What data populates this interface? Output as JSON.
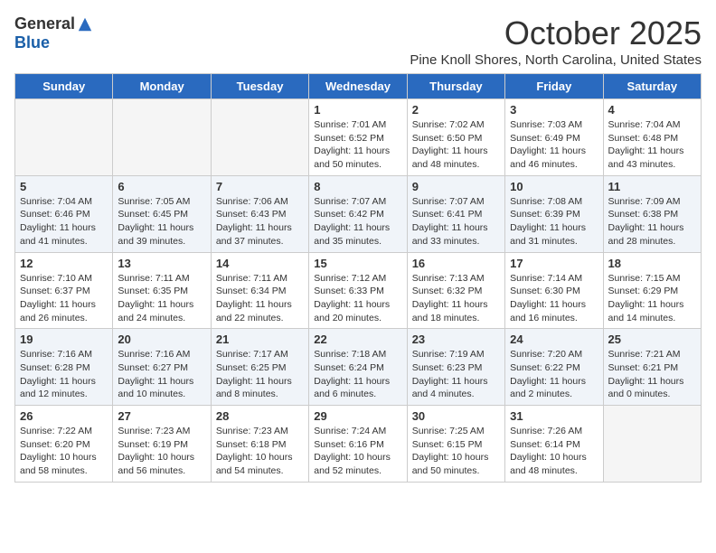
{
  "header": {
    "logo_general": "General",
    "logo_blue": "Blue",
    "month": "October 2025",
    "location": "Pine Knoll Shores, North Carolina, United States"
  },
  "weekdays": [
    "Sunday",
    "Monday",
    "Tuesday",
    "Wednesday",
    "Thursday",
    "Friday",
    "Saturday"
  ],
  "weeks": [
    [
      {
        "day": "",
        "text": ""
      },
      {
        "day": "",
        "text": ""
      },
      {
        "day": "",
        "text": ""
      },
      {
        "day": "1",
        "text": "Sunrise: 7:01 AM\nSunset: 6:52 PM\nDaylight: 11 hours and 50 minutes."
      },
      {
        "day": "2",
        "text": "Sunrise: 7:02 AM\nSunset: 6:50 PM\nDaylight: 11 hours and 48 minutes."
      },
      {
        "day": "3",
        "text": "Sunrise: 7:03 AM\nSunset: 6:49 PM\nDaylight: 11 hours and 46 minutes."
      },
      {
        "day": "4",
        "text": "Sunrise: 7:04 AM\nSunset: 6:48 PM\nDaylight: 11 hours and 43 minutes."
      }
    ],
    [
      {
        "day": "5",
        "text": "Sunrise: 7:04 AM\nSunset: 6:46 PM\nDaylight: 11 hours and 41 minutes."
      },
      {
        "day": "6",
        "text": "Sunrise: 7:05 AM\nSunset: 6:45 PM\nDaylight: 11 hours and 39 minutes."
      },
      {
        "day": "7",
        "text": "Sunrise: 7:06 AM\nSunset: 6:43 PM\nDaylight: 11 hours and 37 minutes."
      },
      {
        "day": "8",
        "text": "Sunrise: 7:07 AM\nSunset: 6:42 PM\nDaylight: 11 hours and 35 minutes."
      },
      {
        "day": "9",
        "text": "Sunrise: 7:07 AM\nSunset: 6:41 PM\nDaylight: 11 hours and 33 minutes."
      },
      {
        "day": "10",
        "text": "Sunrise: 7:08 AM\nSunset: 6:39 PM\nDaylight: 11 hours and 31 minutes."
      },
      {
        "day": "11",
        "text": "Sunrise: 7:09 AM\nSunset: 6:38 PM\nDaylight: 11 hours and 28 minutes."
      }
    ],
    [
      {
        "day": "12",
        "text": "Sunrise: 7:10 AM\nSunset: 6:37 PM\nDaylight: 11 hours and 26 minutes."
      },
      {
        "day": "13",
        "text": "Sunrise: 7:11 AM\nSunset: 6:35 PM\nDaylight: 11 hours and 24 minutes."
      },
      {
        "day": "14",
        "text": "Sunrise: 7:11 AM\nSunset: 6:34 PM\nDaylight: 11 hours and 22 minutes."
      },
      {
        "day": "15",
        "text": "Sunrise: 7:12 AM\nSunset: 6:33 PM\nDaylight: 11 hours and 20 minutes."
      },
      {
        "day": "16",
        "text": "Sunrise: 7:13 AM\nSunset: 6:32 PM\nDaylight: 11 hours and 18 minutes."
      },
      {
        "day": "17",
        "text": "Sunrise: 7:14 AM\nSunset: 6:30 PM\nDaylight: 11 hours and 16 minutes."
      },
      {
        "day": "18",
        "text": "Sunrise: 7:15 AM\nSunset: 6:29 PM\nDaylight: 11 hours and 14 minutes."
      }
    ],
    [
      {
        "day": "19",
        "text": "Sunrise: 7:16 AM\nSunset: 6:28 PM\nDaylight: 11 hours and 12 minutes."
      },
      {
        "day": "20",
        "text": "Sunrise: 7:16 AM\nSunset: 6:27 PM\nDaylight: 11 hours and 10 minutes."
      },
      {
        "day": "21",
        "text": "Sunrise: 7:17 AM\nSunset: 6:25 PM\nDaylight: 11 hours and 8 minutes."
      },
      {
        "day": "22",
        "text": "Sunrise: 7:18 AM\nSunset: 6:24 PM\nDaylight: 11 hours and 6 minutes."
      },
      {
        "day": "23",
        "text": "Sunrise: 7:19 AM\nSunset: 6:23 PM\nDaylight: 11 hours and 4 minutes."
      },
      {
        "day": "24",
        "text": "Sunrise: 7:20 AM\nSunset: 6:22 PM\nDaylight: 11 hours and 2 minutes."
      },
      {
        "day": "25",
        "text": "Sunrise: 7:21 AM\nSunset: 6:21 PM\nDaylight: 11 hours and 0 minutes."
      }
    ],
    [
      {
        "day": "26",
        "text": "Sunrise: 7:22 AM\nSunset: 6:20 PM\nDaylight: 10 hours and 58 minutes."
      },
      {
        "day": "27",
        "text": "Sunrise: 7:23 AM\nSunset: 6:19 PM\nDaylight: 10 hours and 56 minutes."
      },
      {
        "day": "28",
        "text": "Sunrise: 7:23 AM\nSunset: 6:18 PM\nDaylight: 10 hours and 54 minutes."
      },
      {
        "day": "29",
        "text": "Sunrise: 7:24 AM\nSunset: 6:16 PM\nDaylight: 10 hours and 52 minutes."
      },
      {
        "day": "30",
        "text": "Sunrise: 7:25 AM\nSunset: 6:15 PM\nDaylight: 10 hours and 50 minutes."
      },
      {
        "day": "31",
        "text": "Sunrise: 7:26 AM\nSunset: 6:14 PM\nDaylight: 10 hours and 48 minutes."
      },
      {
        "day": "",
        "text": ""
      }
    ]
  ]
}
